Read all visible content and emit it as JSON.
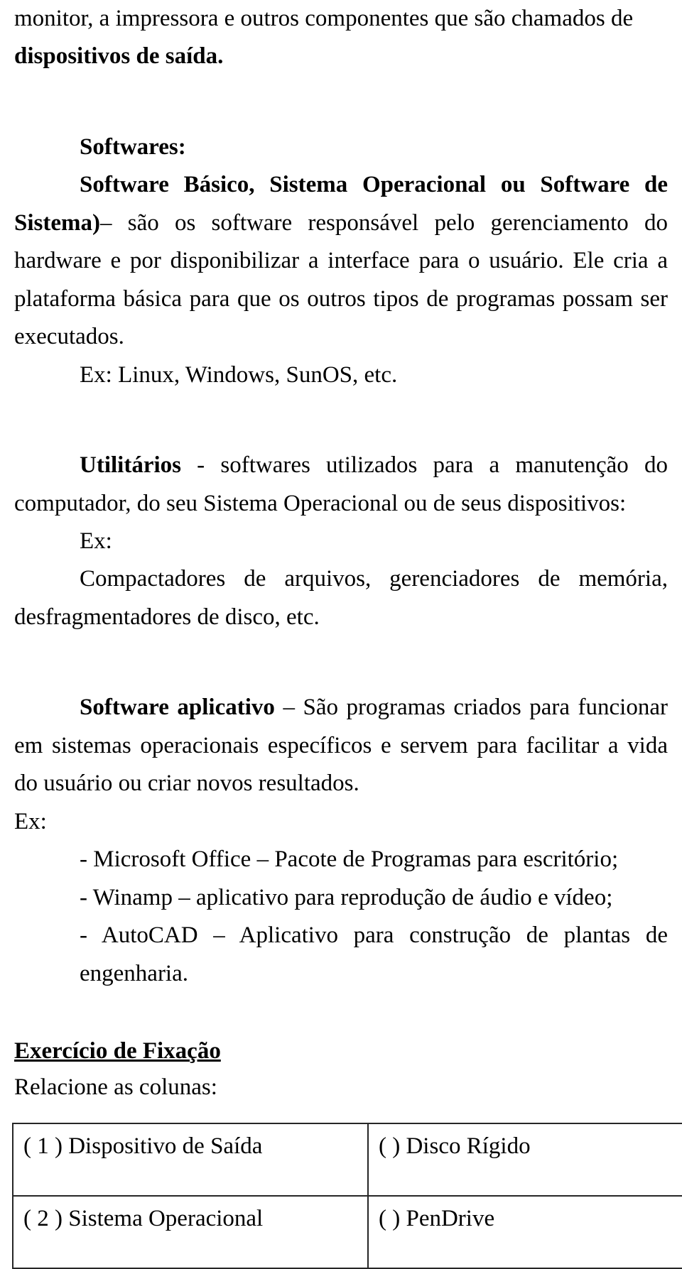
{
  "document": {
    "language": "pt-BR",
    "paragraphs": {
      "intro_continuation": "monitor, a impressora e outros componentes que são chamados de",
      "intro_bold_end": "dispositivos de saída.",
      "softwares_heading": "Softwares:",
      "so_bold_lead": "Software Básico, Sistema Operacional ou Software de Sistema)",
      "so_body": "– são os software responsável pelo gerenciamento do hardware e por disponibilizar a interface para o usuário. Ele cria a plataforma básica para que os outros tipos de programas possam ser executados.",
      "so_example": "Ex:  Linux, Windows, SunOS, etc.",
      "utilitarios_bold_lead": "Utilitários",
      "utilitarios_body": " - softwares utilizados para a manutenção do computador, do seu Sistema Operacional ou de seus dispositivos:",
      "utilitarios_ex_label": "Ex:",
      "utilitarios_examples": "Compactadores de arquivos, gerenciadores de memória, desfragmentadores de disco, etc.",
      "aplicativo_bold_lead": "Software aplicativo",
      "aplicativo_body": " – São programas criados para funcionar em sistemas operacionais específicos e servem para facilitar a vida do usuário ou criar novos resultados.",
      "aplicativo_ex_label": "Ex:",
      "aplicativo_items": [
        "- Microsoft Office – Pacote de Programas para escritório;",
        "- Winamp – aplicativo para reprodução de áudio e vídeo;",
        "- AutoCAD – Aplicativo para construção de plantas de engenharia."
      ]
    },
    "exercise": {
      "title": "Exercício de Fixação",
      "instruction": "Relacione as colunas:",
      "table_rows": [
        {
          "left": "( 1 ) Dispositivo de Saída",
          "right": "(   ) Disco Rígido"
        },
        {
          "left": "( 2 ) Sistema Operacional",
          "right": "(   ) PenDrive"
        }
      ]
    }
  }
}
